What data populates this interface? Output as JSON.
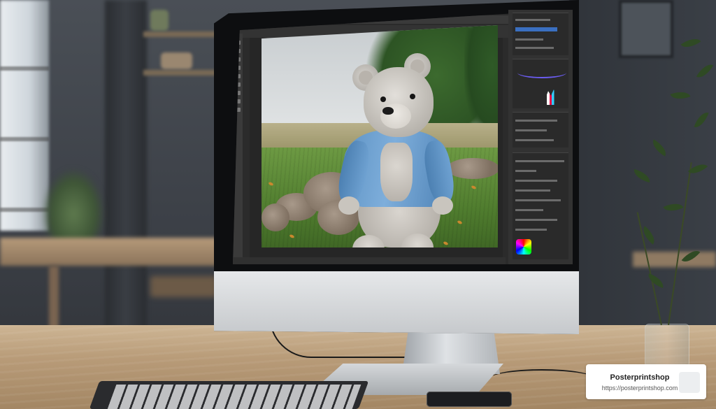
{
  "watermark": {
    "brand": "Posterprintshop",
    "url": "https://posterprintshop.com"
  },
  "colors": {
    "jacket": "#6a9fd0",
    "bear_fur": "#cfcbc5",
    "grass": "#5a8a36",
    "desk": "#b99c78",
    "monitor_chin": "#d8dadc"
  },
  "scene": {
    "icons": [
      "photoshop-toolbar",
      "layers-panel",
      "histogram",
      "color-wheel"
    ]
  }
}
